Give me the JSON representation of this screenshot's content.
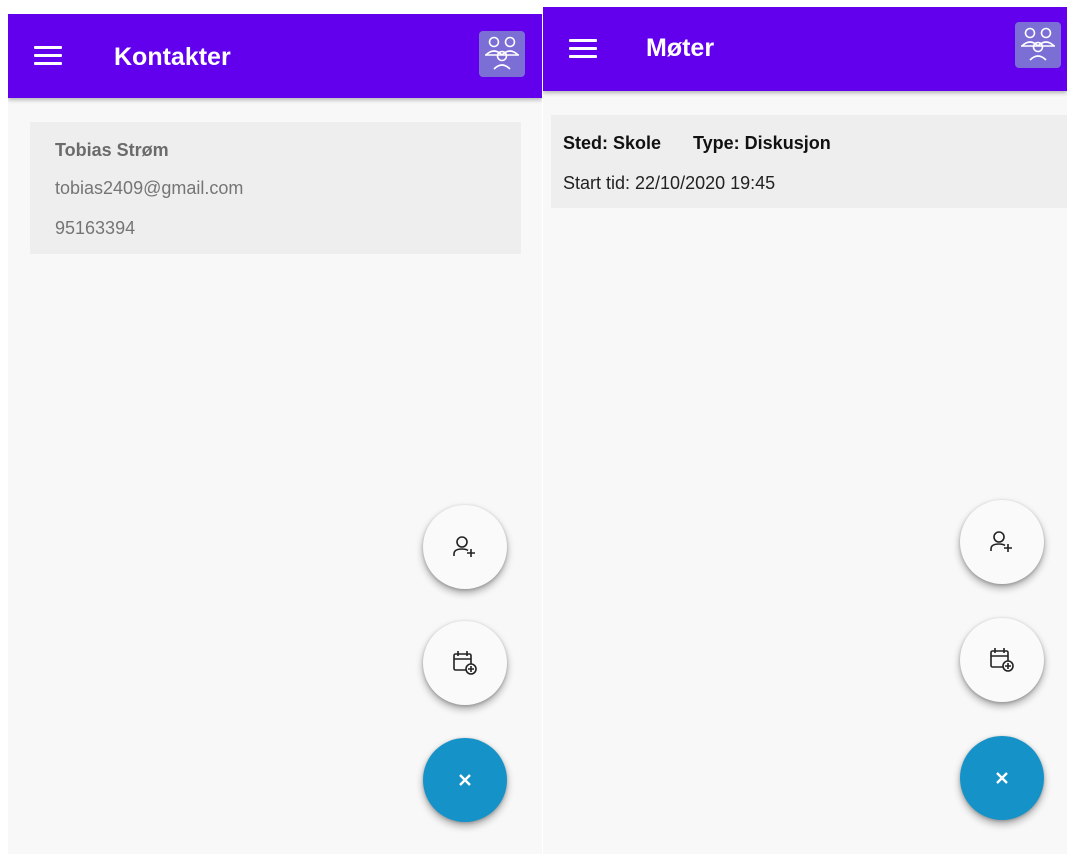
{
  "contacts_screen": {
    "title": "Kontakter",
    "contact": {
      "name": "Tobias Strøm",
      "email": "tobias2409@gmail.com",
      "phone": "95163394"
    }
  },
  "meetings_screen": {
    "title": "Møter",
    "meeting": {
      "place": "Sted: Skole",
      "type": "Type: Diskusjon",
      "start_time": "Start tid: 22/10/2020 19:45"
    }
  },
  "icons": {
    "menu": "hamburger-menu-icon",
    "group": "group-people-icon",
    "add_contact": "person-add-icon",
    "add_meeting": "calendar-add-icon",
    "close": "close-icon"
  },
  "colors": {
    "appbar": "#6200ee",
    "fab_close": "#1593c9",
    "card": "#eeeeee",
    "background": "#f8f8f8"
  }
}
